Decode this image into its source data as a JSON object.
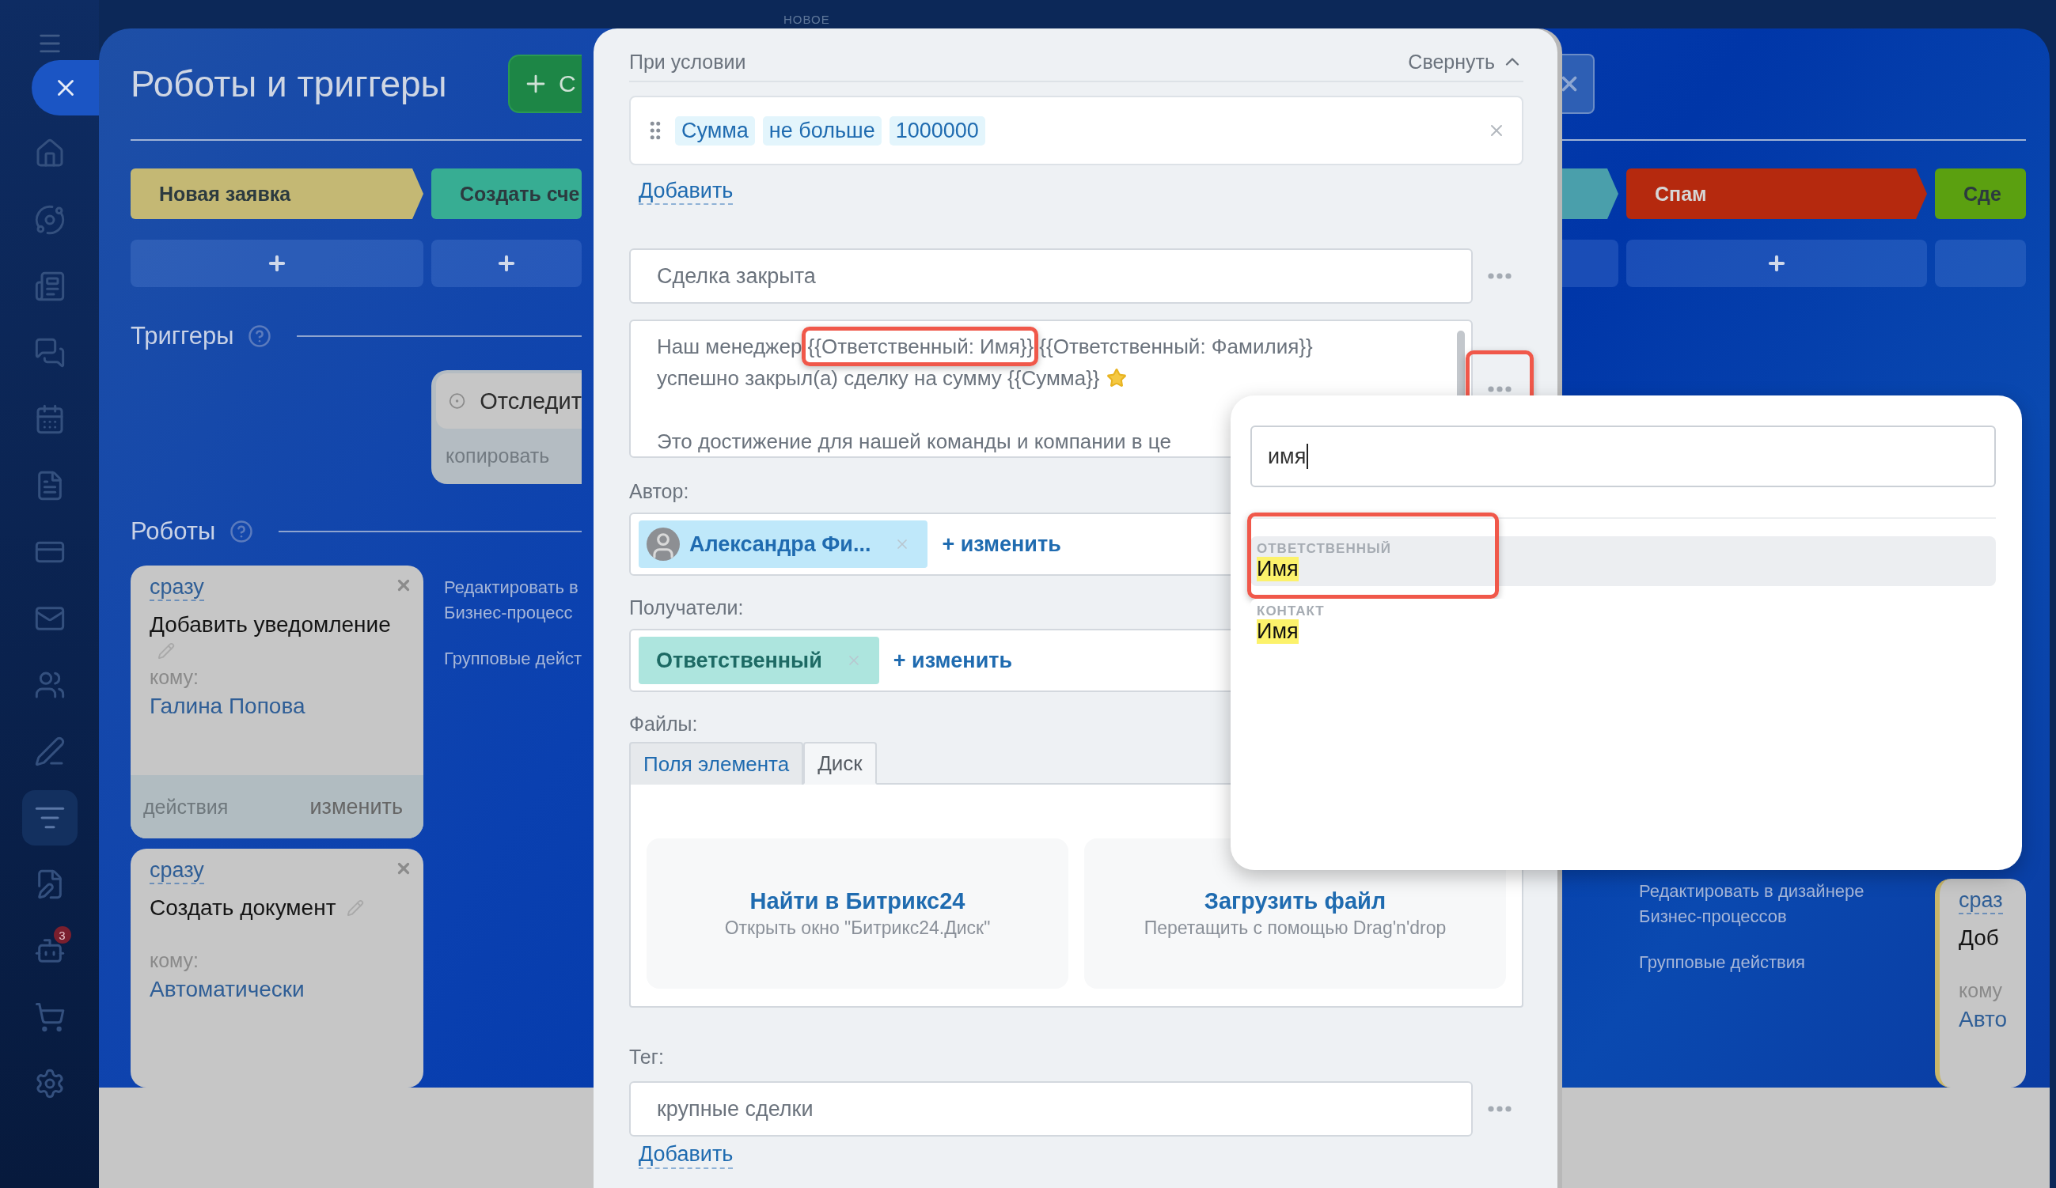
{
  "top_label": "НОВОЕ",
  "sidebar": {
    "items": [
      {
        "selected": false
      },
      {
        "selected": false
      },
      {
        "selected": false
      },
      {
        "selected": false
      },
      {
        "selected": false
      },
      {
        "selected": false
      },
      {
        "selected": false
      },
      {
        "selected": false
      },
      {
        "selected": false
      },
      {
        "selected": false
      },
      {
        "selected": true
      },
      {
        "selected": false
      },
      {
        "selected": false,
        "badge": "3"
      },
      {
        "selected": false
      },
      {
        "selected": false
      }
    ]
  },
  "board": {
    "title": "Роботы и триггеры",
    "create_button": "С",
    "left_stages": [
      {
        "name": "Новая заявка",
        "color": "#c4b874",
        "plus": true
      },
      {
        "name": "Создать сче",
        "color": "#37ad93",
        "plus": true
      }
    ],
    "right_stages": [
      {
        "color": "#4a9fab",
        "plus": false
      },
      {
        "name": "Спам",
        "color": "#b5290e",
        "plus": true
      },
      {
        "name": "Сде",
        "color": "#5ba010",
        "plus": false
      }
    ],
    "triggers": {
      "heading": "Триггеры",
      "card": {
        "title": "Отследит",
        "action": "копировать"
      }
    },
    "robots": {
      "heading": "Роботы",
      "cards": [
        {
          "delay": "сразу",
          "title": "Добавить уведомление",
          "to_label": "кому:",
          "to": "Галина Попова",
          "footer": {
            "left": "действия",
            "right": "изменить"
          }
        },
        {
          "delay": "сразу",
          "title": "Создать документ",
          "to_label": "кому:",
          "to": "Автоматически"
        }
      ]
    },
    "left_links": [
      {
        "lines": [
          "Редактировать в",
          "Бизнес-процесс"
        ]
      },
      {
        "lines": [
          "Групповые дейст"
        ]
      }
    ],
    "right_links": [
      {
        "lines": [
          "Редактировать в дизайнере",
          "Бизнес-процессов"
        ]
      },
      {
        "lines": [
          "Групповые действия"
        ]
      }
    ],
    "right_card": {
      "delay": "сраз",
      "title": "Доб",
      "to_label": "кому",
      "to": "Авто"
    }
  },
  "modal": {
    "condition_title": "При условии",
    "collapse": "Свернуть",
    "condition_chips": [
      "Сумма",
      "не больше",
      "1000000"
    ],
    "add_condition": "Добавить",
    "subject": "Сделка закрыта",
    "message": {
      "paragraphs": [
        {
          "lines": [
            {
              "segments": [
                {
                  "text": "Наш менеджер ",
                  "highlighted": false
                },
                {
                  "text": "{{Ответственный: Имя}}",
                  "highlighted": true
                },
                {
                  "text": " {{Ответственный: Фамилия}}",
                  "highlighted": false
                }
              ]
            },
            {
              "segments": [
                {
                  "text": "успешно закрыл(а) сделку на сумму {{Сумма}}",
                  "highlighted": false
                }
              ],
              "starred": true
            }
          ]
        },
        {
          "lines": [
            {
              "segments": [
                {
                  "text": "Это достижение для нашей команды и компании в це",
                  "highlighted": false
                }
              ]
            }
          ]
        }
      ]
    },
    "message_menu_highlighted": true,
    "author_label": "Автор:",
    "author": "Александра Фи...",
    "author_change": "+ изменить",
    "recipients_label": "Получатели:",
    "recipient": "Ответственный",
    "recipient_change": "+ изменить",
    "files_label": "Файлы:",
    "file_tabs": [
      {
        "label": "Поля элемента",
        "selected": false
      },
      {
        "label": "Диск",
        "selected": true
      }
    ],
    "file_actions": [
      {
        "title": "Найти в Битрикс24",
        "subtitle": "Открыть окно \"Битрикс24.Диск\""
      },
      {
        "title": "Загрузить файл",
        "subtitle": "Перетащить с помощью Drag'n'drop"
      }
    ],
    "tag_label": "Тег:",
    "tag_value": "крупные сделки",
    "add_tag": "Добавить"
  },
  "popup": {
    "search": "имя",
    "items": [
      {
        "group": "ОТВЕТСТВЕННЫЙ",
        "label": "Имя",
        "selected": true,
        "highlighted": true
      },
      {
        "group": "КОНТАКТ",
        "label": "Имя",
        "selected": false,
        "highlighted": false
      }
    ]
  }
}
